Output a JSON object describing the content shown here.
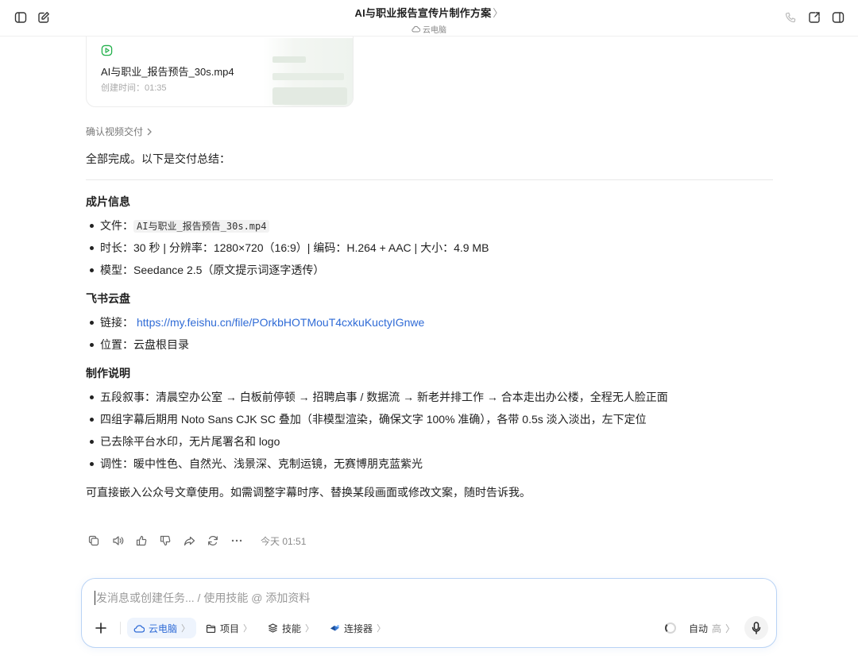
{
  "header": {
    "title": "AI与职业报告宣传片制作方案",
    "title_chevron": "〉",
    "subtitle": "云电脑"
  },
  "video_card": {
    "filename": "AI与职业_报告预告_30s.mp4",
    "created": "创建时间：01:35"
  },
  "confirm_link": "确认视频交付",
  "message": {
    "lead": "全部完成。以下是交付总结：",
    "sections": [
      {
        "heading": "成片信息",
        "items": [
          {
            "prefix": "文件：",
            "code": "AI与职业_报告预告_30s.mp4"
          },
          {
            "text": "时长：30 秒 | 分辨率：1280×720（16:9）| 编码：H.264 + AAC | 大小：4.9 MB"
          },
          {
            "text": "模型：Seedance 2.5（原文提示词逐字透传）"
          }
        ]
      },
      {
        "heading": "飞书云盘",
        "items": [
          {
            "prefix": "链接：",
            "link": "https://my.feishu.cn/file/POrkbHOTMouT4cxkuKuctyIGnwe"
          },
          {
            "text": "位置：云盘根目录"
          }
        ]
      },
      {
        "heading": "制作说明",
        "items": [
          {
            "text": "五段叙事：清晨空办公室 → 白板前停顿 → 招聘启事 / 数据流 → 新老并排工作 → 合本走出办公楼，全程无人脸正面"
          },
          {
            "text": "四组字幕后期用 Noto Sans CJK SC 叠加（非模型渲染，确保文字 100% 准确），各带 0.5s 淡入淡出，左下定位"
          },
          {
            "text": "已去除平台水印，无片尾署名和 logo"
          },
          {
            "text": "调性：暖中性色、自然光、浅景深、克制运镜，无赛博朋克蓝紫光"
          }
        ]
      }
    ],
    "closing": "可直接嵌入公众号文章使用。如需调整字幕时序、替换某段画面或修改文案，随时告诉我。",
    "timestamp": "今天 01:51"
  },
  "composer": {
    "placeholder": "发消息或创建任务... / 使用技能 @ 添加资料",
    "chips": [
      "云电脑",
      "项目",
      "技能",
      "连接器"
    ],
    "chip_chevron": "〉",
    "mode": "自动",
    "quality": "高",
    "mode_chevron": "〉"
  },
  "colors": {
    "accent": "#2f6bd6",
    "composer_border": "#b9d3f5",
    "video_icon": "#22b04b"
  }
}
